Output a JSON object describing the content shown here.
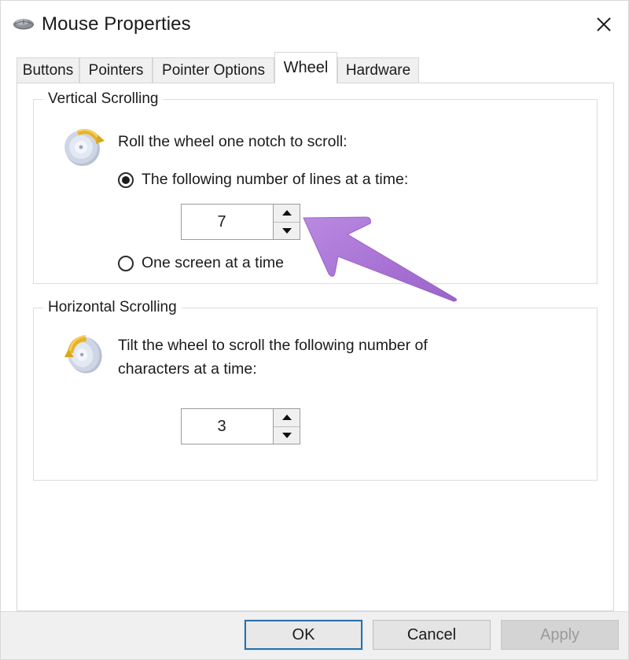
{
  "window": {
    "title": "Mouse Properties",
    "icon": "mouse-icon",
    "close_label": "✕"
  },
  "tabs": [
    {
      "label": "Buttons",
      "active": false
    },
    {
      "label": "Pointers",
      "active": false
    },
    {
      "label": "Pointer Options",
      "active": false
    },
    {
      "label": "Wheel",
      "active": true
    },
    {
      "label": "Hardware",
      "active": false
    }
  ],
  "vertical_scrolling": {
    "legend": "Vertical Scrolling",
    "icon": "mouse-wheel-vertical-icon",
    "description": "Roll the wheel one notch to scroll:",
    "options": [
      {
        "label": "The following number of lines at a time:",
        "selected": true
      },
      {
        "label": "One screen at a time",
        "selected": false
      }
    ],
    "lines_value": "7",
    "spinner_up": "▲",
    "spinner_down": "▼"
  },
  "horizontal_scrolling": {
    "legend": "Horizontal Scrolling",
    "icon": "mouse-wheel-horizontal-icon",
    "description": "Tilt the wheel to scroll the following number of\ncharacters at a time:",
    "characters_value": "3",
    "spinner_up": "▲",
    "spinner_down": "▼"
  },
  "footer": {
    "ok_label": "OK",
    "cancel_label": "Cancel",
    "apply_label": "Apply",
    "apply_disabled": true
  },
  "annotation": {
    "type": "arrow-pointer",
    "color": "#a97ad6",
    "points_to": "vertical-lines-spinner"
  },
  "colors": {
    "window_bg": "#ffffff",
    "footer_bg": "#f0f0f0",
    "tab_inactive_bg": "#f0f0f0",
    "tab_active_bg": "#ffffff",
    "border": "#d6d6d6",
    "text": "#1b1b1b",
    "default_button_border": "#2a6fa8",
    "disabled_text": "#9a9a9a",
    "annotation_purple": "#a97ad6"
  }
}
